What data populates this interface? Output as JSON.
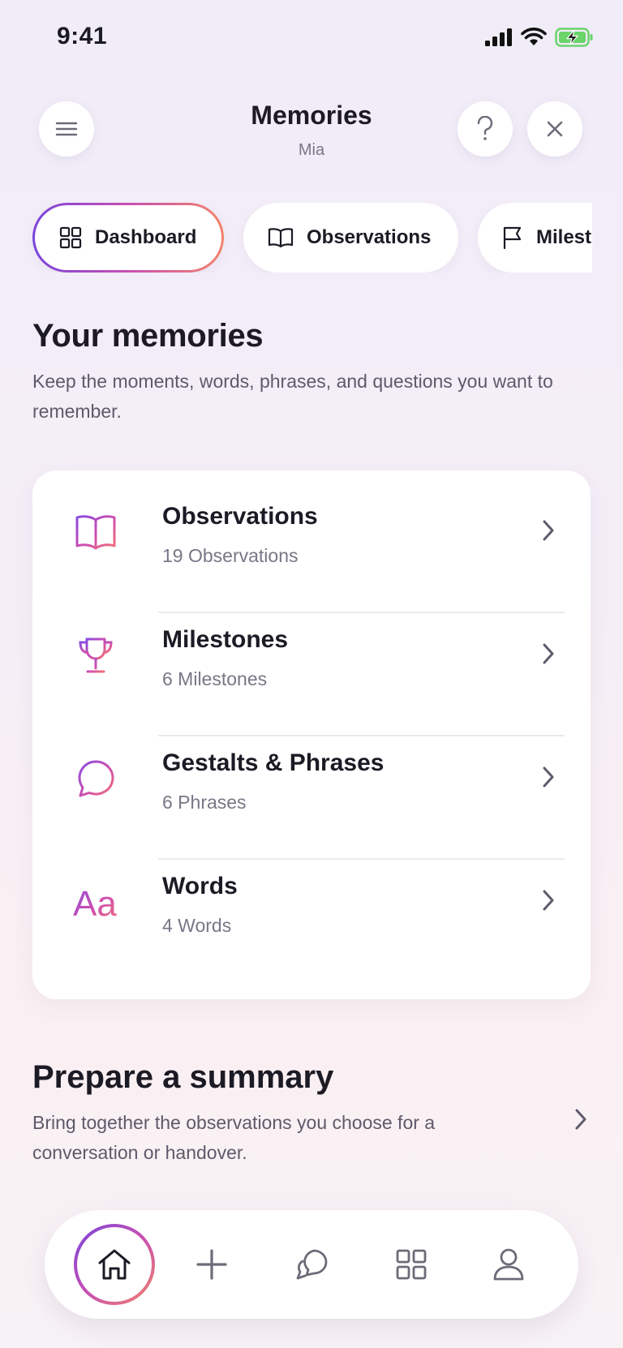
{
  "status_bar": {
    "time": "9:41"
  },
  "header": {
    "title": "Memories",
    "subtitle": "Mia"
  },
  "tabs": [
    {
      "label": "Dashboard",
      "icon": "grid-icon",
      "active": true
    },
    {
      "label": "Observations",
      "icon": "book-icon",
      "active": false
    },
    {
      "label": "Milestones",
      "icon": "flag-icon",
      "active": false
    }
  ],
  "intro": {
    "heading": "Your memories",
    "description": "Keep the moments, words, phrases, and questions you want to remember."
  },
  "memory_list": [
    {
      "title": "Observations",
      "count": "19 Observations",
      "icon": "open-book-icon"
    },
    {
      "title": "Milestones",
      "count": "6 Milestones",
      "icon": "trophy-icon"
    },
    {
      "title": "Gestalts & Phrases",
      "count": "6 Phrases",
      "icon": "speech-bubble-icon"
    },
    {
      "title": "Words",
      "count": "4 Words",
      "icon": "text-aa-icon"
    }
  ],
  "summary": {
    "heading": "Prepare a summary",
    "description": "Bring together the observations you choose for a conversation or handover."
  },
  "bottom_nav": [
    "home-icon",
    "plus-icon",
    "chat-icon",
    "grid-icon",
    "profile-icon"
  ],
  "colors": {
    "gradient_start": "#7a45dc",
    "gradient_mid": "#c74fb2",
    "gradient_end": "#f3846a"
  }
}
